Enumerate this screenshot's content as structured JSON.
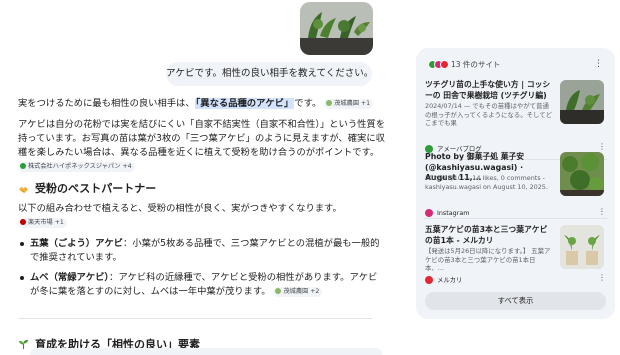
{
  "chat": {
    "user_message": "アケビです。相性の良い相手を教えてください。",
    "para1_pre": "実をつけるために最も相性の良い相手は、",
    "para1_highlight": "「異なる品種のアケビ」",
    "para1_post": "です。",
    "chip1": "茂城農園 +1",
    "para2": "アケビは自分の花粉では実を結びにくい「自家不結実性（自家不和合性）」という性質を持っています。お写真の苗は葉が3枚の「三つ葉アケビ」のように見えますが、確実に収穫を楽しみたい場合は、異なる品種を近くに植えて受粉を助け合うのがポイントです。",
    "chip2": "株式会社ハイポネックスジャパン +4",
    "heading1": "受粉のベストパートナー",
    "para3": "以下の組み合わせで植えると、受粉の相性が良く、実がつきやすくなります。",
    "chip3": "楽天市場 +1",
    "bullet1_term": "五葉（ごよう）アケビ",
    "bullet1_text": "：小葉が5枚ある品種で、三つ葉アケビとの混植が最も一般的で推奨されています。",
    "bullet2_term": "ムベ（常緑アケビ）",
    "bullet2_text": "：アケビ科の近縁種で、アケビと受粉の相性があります。アケビが冬に葉を落とすのに対し、ムベは一年中葉が茂ります。",
    "chip4": "茂城農園 +2",
    "heading2": "育成を助ける「相性の良い」要素"
  },
  "sources": {
    "count_label": "13 件のサイト",
    "show_all": "すべて表示",
    "cards": [
      {
        "title": "ツチグリ苗の上手な使い方 | コッシーの 田舎で果樹栽培 (ツチグリ編)",
        "snippet": "2024/07/14 — でもその苗種はやがて普通の根っ子が入ってくるようになる。そしてどこまでも果",
        "source": "アメーバブログ"
      },
      {
        "title": "Photo by 御菓子処 菓子安 (@kashiyasu.wagasi) · August 11,...",
        "snippet": "2025/08/10 — 14 likes, 0 comments - kashiyasu.wagasi on August 10, 2025.",
        "source": "Instagram"
      },
      {
        "title": "五葉アケビの苗3本と三つ葉アケビの苗1本 - メルカリ",
        "snippet": "【発送は5月26日以降になります。】 五葉アケビの苗3本と三つ葉アケビの苗1本日本、...",
        "source": "メルカリ"
      }
    ]
  },
  "colors": {
    "highlight": "#d3e3fd",
    "panel_bg": "#f0f4f9",
    "ameba": "#2d9d3a",
    "instagram": "#d62976",
    "mercari": "#e3262f"
  }
}
